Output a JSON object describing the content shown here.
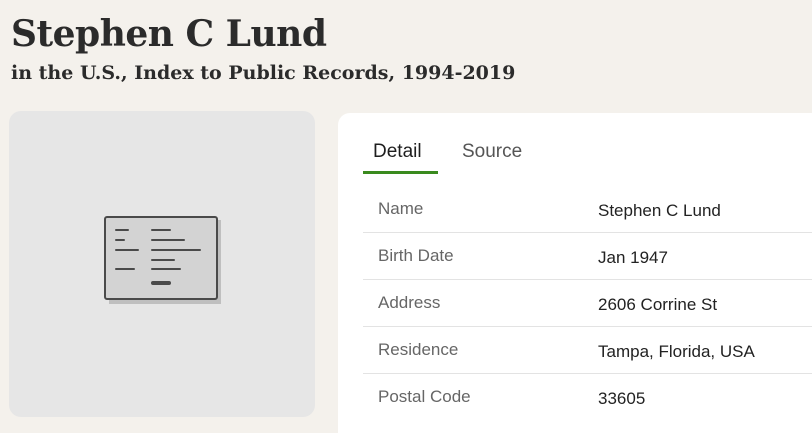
{
  "record": {
    "name": "Stephen C Lund",
    "collection": "in the U.S., Index to Public Records, 1994-2019"
  },
  "tabs": [
    {
      "label": "Detail",
      "active": true
    },
    {
      "label": "Source",
      "active": false
    }
  ],
  "fields": [
    {
      "label": "Name",
      "value": "Stephen C Lund"
    },
    {
      "label": "Birth Date",
      "value": "Jan 1947"
    },
    {
      "label": "Address",
      "value": "2606 Corrine St"
    },
    {
      "label": "Residence",
      "value": "Tampa, Florida, USA"
    },
    {
      "label": "Postal Code",
      "value": "33605"
    }
  ],
  "image": {
    "icon": "record-document-icon"
  },
  "colors": {
    "background": "#f4f1ec",
    "accent": "#3a8a1e",
    "panel": "#ffffff",
    "image_card": "#e6e6e6"
  }
}
